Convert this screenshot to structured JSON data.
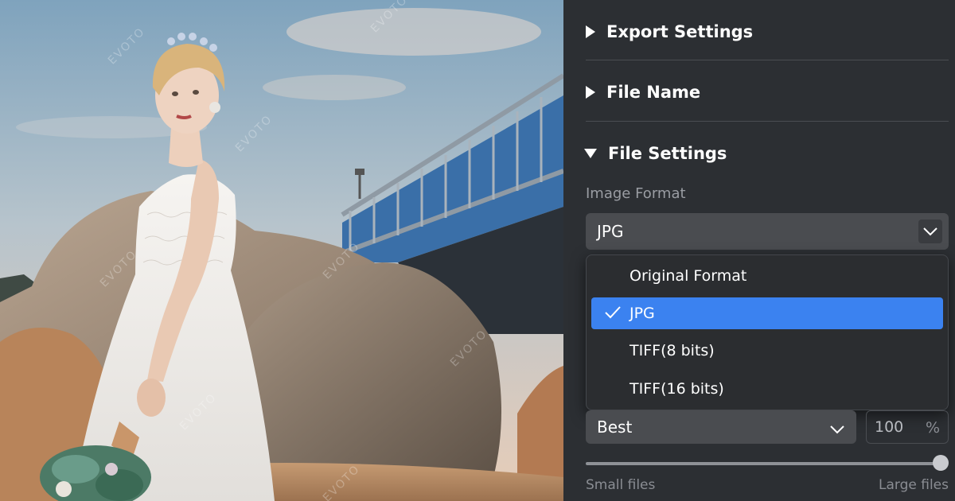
{
  "preview": {
    "watermark_text": "EVOTO"
  },
  "sections": {
    "export_settings": {
      "title": "Export Settings",
      "expanded": false
    },
    "file_name": {
      "title": "File Name",
      "expanded": false
    },
    "file_settings": {
      "title": "File Settings",
      "expanded": true
    }
  },
  "image_format": {
    "label": "Image Format",
    "value": "JPG",
    "options": [
      {
        "label": "Original Format",
        "selected": false
      },
      {
        "label": "JPG",
        "selected": true
      },
      {
        "label": "TIFF(8 bits)",
        "selected": false
      },
      {
        "label": "TIFF(16 bits)",
        "selected": false
      }
    ]
  },
  "quality": {
    "value": "Best",
    "percent": "100",
    "unit": "%",
    "slider_level": 1.0,
    "min_label": "Small files",
    "max_label": "Large files"
  },
  "colors": {
    "panel_bg": "#2c2f33",
    "field_bg": "#4a4c50",
    "accent": "#3b82f0",
    "muted_text": "#9a9da3"
  },
  "icons": {
    "collapsed": "triangle-right-icon",
    "expanded": "triangle-down-icon",
    "dropdown": "chevron-down-icon",
    "selected": "checkmark-icon"
  }
}
